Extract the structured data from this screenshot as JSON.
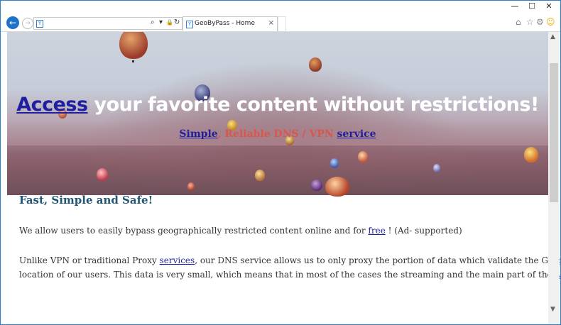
{
  "window": {
    "minimize": "—",
    "maximize": "☐",
    "close": "✕"
  },
  "navbar": {
    "back_icon": "←",
    "forward_icon": "→",
    "address_value": "",
    "search_icon": "⌕",
    "dropdown_icon": "▾",
    "lock_icon": "🔒",
    "refresh_icon": "↻",
    "home_icon": "⌂",
    "star_icon": "☆",
    "gear_icon": "⚙",
    "smiley_icon": "☺"
  },
  "tab": {
    "title": "GeoByPass - Home",
    "close": "×"
  },
  "hero": {
    "title_link": "Access",
    "title_rest": " your favorite content without restrictions!",
    "sub_link1": "Simple",
    "sub_mid": ", Reliable DNS / VPN ",
    "sub_link2": "service"
  },
  "content": {
    "heading": "Fast, Simple and Safe!",
    "p1_a": "We allow users to easily bypass geographically restricted content online and for ",
    "p1_link": "free",
    "p1_b": " ! (Ad- supported)",
    "p2_a": "Unlike VPN or traditional Proxy ",
    "p2_link": "services",
    "p2_b": ", our DNS service allows us to only proxy the portion of data which validate the Geographic",
    "p3": "location of our users. This data is very small, which means that in most of the cases the streaming and the main part of the ",
    "p3_link": "web"
  },
  "colors": {
    "accent": "#2b7fd4",
    "link": "#1f1fa0",
    "heading": "#1f5676",
    "subtitle": "#d9564a"
  }
}
